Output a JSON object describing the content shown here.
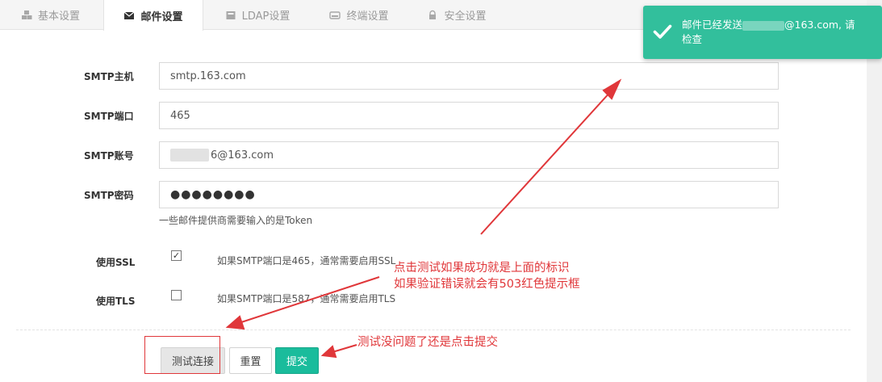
{
  "tabs": [
    {
      "label": "基本设置",
      "icon": "cubes-icon"
    },
    {
      "label": "邮件设置",
      "icon": "envelope-icon"
    },
    {
      "label": "LDAP设置",
      "icon": "ldap-icon"
    },
    {
      "label": "终端设置",
      "icon": "terminal-icon"
    },
    {
      "label": "安全设置",
      "icon": "lock-icon"
    }
  ],
  "form": {
    "smtp_host": {
      "label": "SMTP主机",
      "value": "smtp.163.com"
    },
    "smtp_port": {
      "label": "SMTP端口",
      "value": "465"
    },
    "smtp_user": {
      "label": "SMTP账号",
      "value_suffix": "6@163.com"
    },
    "smtp_password": {
      "label": "SMTP密码",
      "value": "●●●●●●●●",
      "help": "一些邮件提供商需要输入的是Token"
    },
    "use_ssl": {
      "label": "使用SSL",
      "checked": true,
      "hint": "如果SMTP端口是465，通常需要启用SSL"
    },
    "use_tls": {
      "label": "使用TLS",
      "checked": false,
      "hint": "如果SMTP端口是587，通常需要启用TLS"
    }
  },
  "buttons": {
    "test": "测试连接",
    "reset": "重置",
    "submit": "提交"
  },
  "toast": {
    "prefix": "邮件已经发送",
    "suffix": "@163.com, 请",
    "line2": "检查",
    "color": "#32bf9c"
  },
  "annotations": {
    "line1": "点击测试如果成功就是上面的标识",
    "line2": "如果验证错误就会有503红色提示框",
    "line3": "测试没问题了还是点击提交",
    "color": "#e0373a"
  },
  "colors": {
    "accent": "#1abc9c",
    "annotation": "#e0373a"
  }
}
